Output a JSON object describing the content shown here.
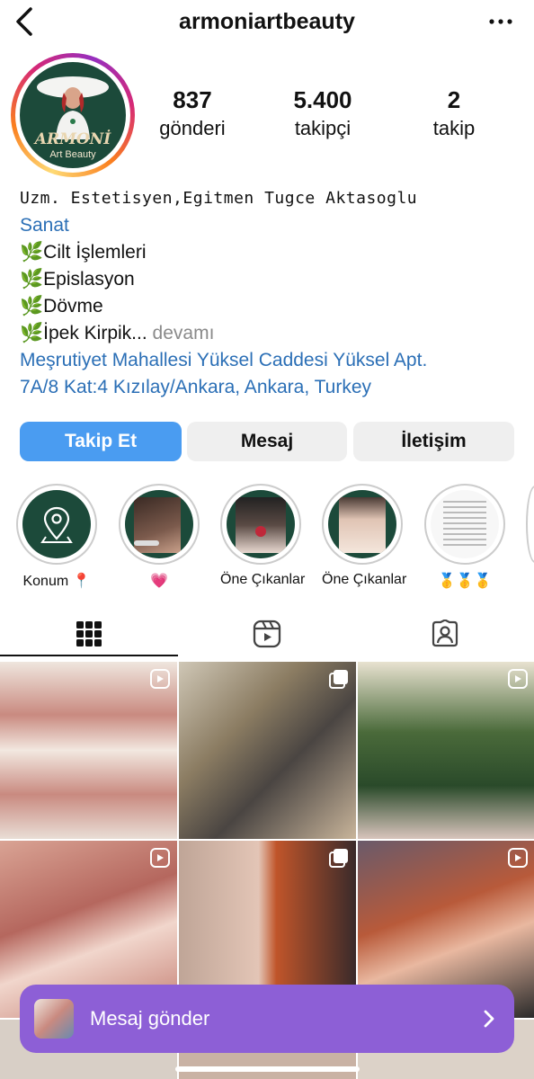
{
  "header": {
    "username": "armoniartbeauty"
  },
  "avatar": {
    "logo_title": "ARMONİ",
    "logo_subtitle": "Art Beauty"
  },
  "stats": [
    {
      "value": "837",
      "label": "gönderi"
    },
    {
      "value": "5.400",
      "label": "takipçi"
    },
    {
      "value": "2",
      "label": "takip"
    }
  ],
  "bio": {
    "name": "Uzm. Estetisyen,Egitmen Tugce Aktasoglu",
    "category": "Sanat",
    "lines": [
      "🌿Cilt İşlemleri",
      "🌿Epislasyon",
      "🌿Dövme",
      "🌿İpek Kirpik..."
    ],
    "more": "devamı",
    "address_line1": "Meşrutiyet Mahallesi Yüksel Caddesi Yüksel Apt.",
    "address_line2": "7A/8 Kat:4 Kızılay/Ankara, Ankara, Turkey"
  },
  "buttons": {
    "follow": "Takip Et",
    "message": "Mesaj",
    "contact": "İletişim"
  },
  "highlights": [
    {
      "label": "Konum 📍",
      "icon": "location-pin-icon"
    },
    {
      "label": "💗"
    },
    {
      "label": "Öne Çıkanlar"
    },
    {
      "label": "Öne Çıkanlar"
    },
    {
      "label": "🥇🥇🥇"
    }
  ],
  "tabs": [
    {
      "name": "posts",
      "icon": "grid-icon"
    },
    {
      "name": "reels",
      "icon": "reels-icon"
    },
    {
      "name": "tagged",
      "icon": "tagged-icon"
    }
  ],
  "message_bar": {
    "label": "Mesaj gönder"
  },
  "colors": {
    "accent_blue": "#4a9cf1",
    "link_blue": "#2b6fb6",
    "message_bar": "#8d5fd6",
    "brand_green": "#1c4a3a"
  }
}
